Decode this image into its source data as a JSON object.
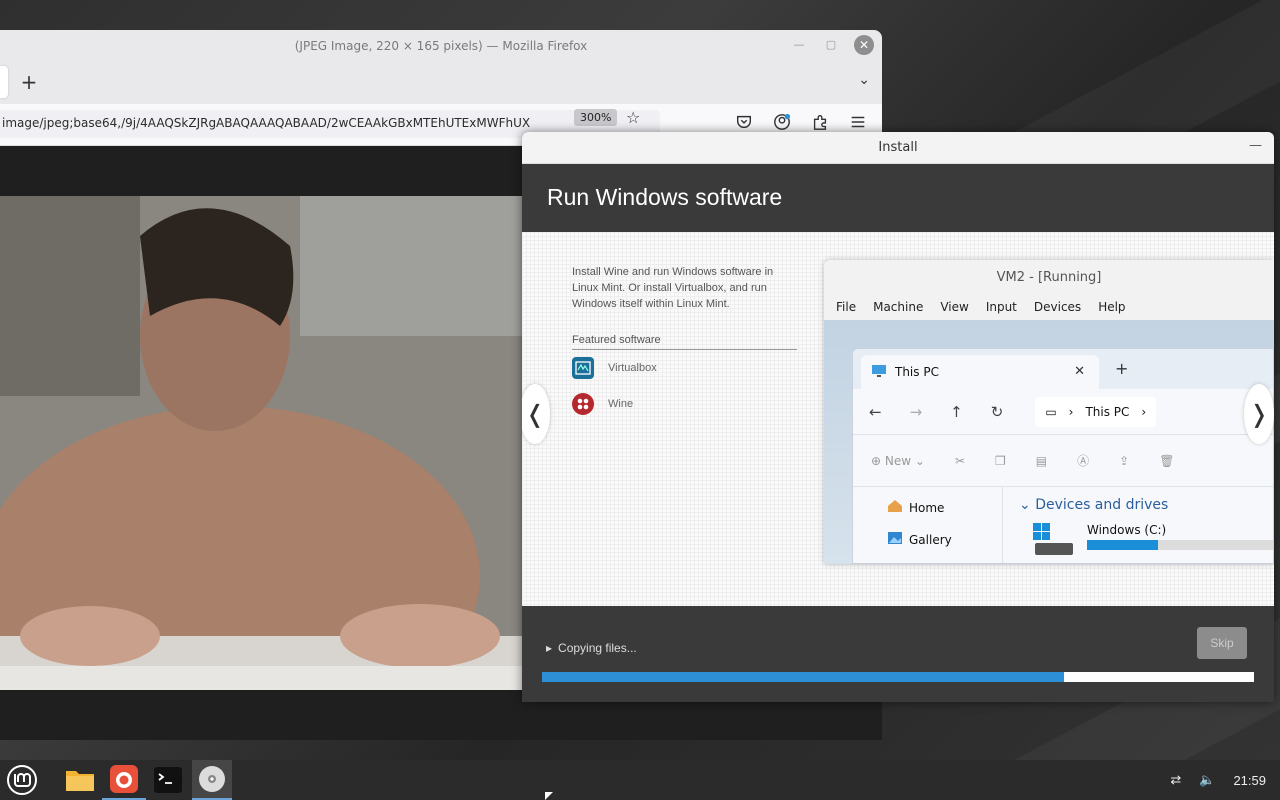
{
  "firefox": {
    "title": "(JPEG Image, 220 × 165 pixels) — Mozilla Firefox",
    "url": "image/jpeg;base64,/9j/4AAQSkZJRgABAQAAAQABAAD/2wCEAAkGBxMTEhUTExMWFhUX",
    "zoom": "300%",
    "minimize_icon": "minimize-icon",
    "maximize_icon": "maximize-icon",
    "close_icon": "close-icon"
  },
  "install": {
    "window_title": "Install",
    "heading": "Run Windows software",
    "description": "Install Wine and run Windows software in Linux Mint. Or install Virtualbox, and run Windows itself within Linux Mint.",
    "featured_label": "Featured software",
    "featured": [
      {
        "name": "Virtualbox",
        "icon": "virtualbox-icon",
        "color": "#1b6f99"
      },
      {
        "name": "Wine",
        "icon": "wine-icon",
        "color": "#b5282e"
      }
    ],
    "prev_arrow": "❬",
    "next_arrow": "❭",
    "status": "Copying files...",
    "skip_label": "Skip",
    "progress": 0.733,
    "accent": "#2d8fd5"
  },
  "vm_screenshot": {
    "title": "VM2 - [Running]",
    "menu": [
      "File",
      "Machine",
      "View",
      "Input",
      "Devices",
      "Help"
    ],
    "tab_label": "This PC",
    "address": "This PC",
    "new_label": "New",
    "sidebar": [
      "Home",
      "Gallery"
    ],
    "section": "Devices and drives",
    "drive_name": "Windows (C:)",
    "drive_used": 0.38
  },
  "taskbar": {
    "clock": "21:59",
    "items": [
      "menu-icon",
      "files-icon",
      "firefox-icon",
      "terminal-icon",
      "installer-disc-icon"
    ]
  }
}
